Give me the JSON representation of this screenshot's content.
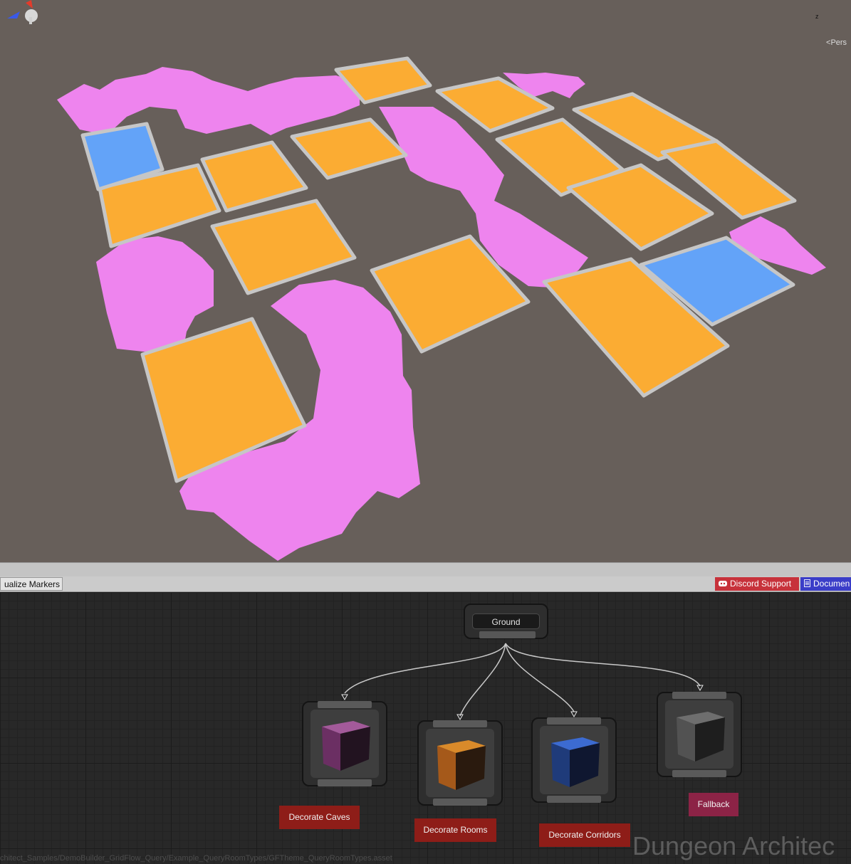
{
  "scene": {
    "view_mode_label": "Pers",
    "gizmo_axis_label": "z",
    "floor_color": "#675f5a",
    "theme_colors": {
      "cave": "#ee84ee",
      "room": "#fbac33",
      "corridor": "#63a3f8",
      "wall": "#b9b9b9"
    }
  },
  "toolbar": {
    "visualize_markers_label": "ualize Markers",
    "discord_support_label": "Discord Support",
    "documentation_label": "Documen"
  },
  "graph": {
    "root_node": {
      "label": "Ground"
    },
    "child_nodes": [
      {
        "id": "caves",
        "label": "Decorate Caves",
        "cube_color": "#7a3a72",
        "label_color": "#8e1d18"
      },
      {
        "id": "rooms",
        "label": "Decorate Rooms",
        "cube_color": "#c46f16",
        "label_color": "#8e1d18"
      },
      {
        "id": "corridors",
        "label": "Decorate Corridors",
        "cube_color": "#2f5bb0",
        "label_color": "#8e1d18"
      },
      {
        "id": "fallback",
        "label": "Fallback",
        "cube_color": "#6a6a6a",
        "label_color": "#8c2346"
      }
    ],
    "watermark": "Dungeon Architec",
    "asset_path": "chitect_Samples/DemoBuilder_GridFlow_Query/Example_QueryRoomTypes/GFTheme_QueryRoomTypes.asset"
  }
}
